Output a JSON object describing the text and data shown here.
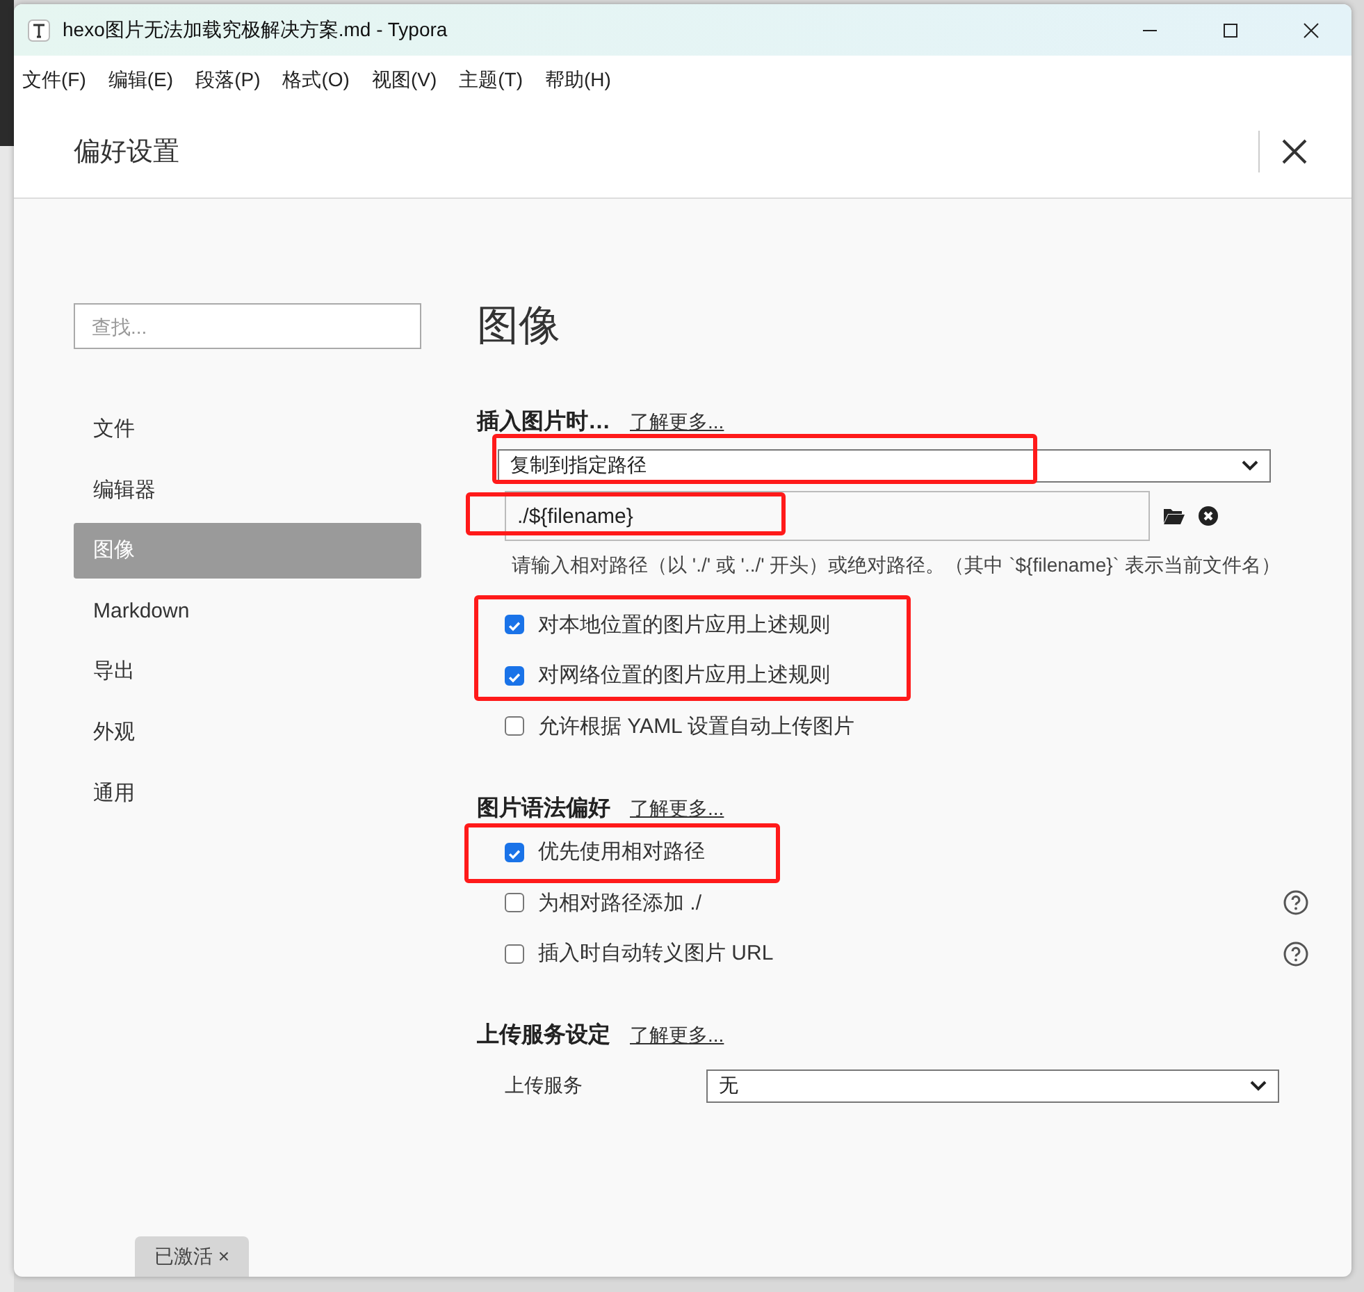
{
  "window": {
    "title": "hexo图片无法加载究极解决方案.md - Typora"
  },
  "menu": [
    "文件(F)",
    "编辑(E)",
    "段落(P)",
    "格式(O)",
    "视图(V)",
    "主题(T)",
    "帮助(H)"
  ],
  "dialog": {
    "title": "偏好设置"
  },
  "search": {
    "placeholder": "查找..."
  },
  "sidebar": {
    "items": [
      {
        "label": "文件",
        "selected": false
      },
      {
        "label": "编辑器",
        "selected": false
      },
      {
        "label": "图像",
        "selected": true
      },
      {
        "label": "Markdown",
        "selected": false
      },
      {
        "label": "导出",
        "selected": false
      },
      {
        "label": "外观",
        "selected": false
      },
      {
        "label": "通用",
        "selected": false
      }
    ]
  },
  "page_title": "图像",
  "sections": [
    {
      "heading": "插入图片时…",
      "link": "了解更多...",
      "items": [
        {
          "kind": "select",
          "value": "复制到指定路径",
          "highlighted": true
        },
        {
          "kind": "path",
          "value": "./${filename}",
          "highlighted": true
        },
        {
          "kind": "hint",
          "text": "请输入相对路径（以 './' 或 '../' 开头）或绝对路径。（其中 `${filename}` 表示当前文件名）"
        },
        {
          "kind": "checks",
          "highlighted": true,
          "options": [
            {
              "label": "对本地位置的图片应用上述规则",
              "checked": true,
              "help": false
            },
            {
              "label": "对网络位置的图片应用上述规则",
              "checked": true,
              "help": false
            }
          ]
        },
        {
          "kind": "checks",
          "highlighted": false,
          "options": [
            {
              "label": "允许根据 YAML 设置自动上传图片",
              "checked": false,
              "help": false
            }
          ]
        }
      ]
    },
    {
      "heading": "图片语法偏好",
      "link": "了解更多...",
      "items": [
        {
          "kind": "checks",
          "highlighted": true,
          "options": [
            {
              "label": "优先使用相对路径",
              "checked": true,
              "help": false
            }
          ]
        },
        {
          "kind": "checks",
          "highlighted": false,
          "options": [
            {
              "label": "为相对路径添加 ./",
              "checked": false,
              "help": true
            },
            {
              "label": "插入时自动转义图片 URL",
              "checked": false,
              "help": true
            }
          ]
        }
      ]
    },
    {
      "heading": "上传服务设定",
      "link": "了解更多...",
      "items": [
        {
          "kind": "labeled_select",
          "label": "上传服务",
          "value": "无"
        }
      ]
    }
  ],
  "badge": "已激活 ×"
}
